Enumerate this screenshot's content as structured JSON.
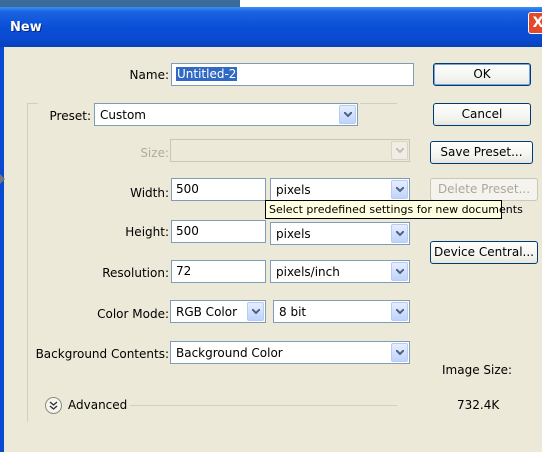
{
  "window": {
    "title": "New",
    "close_glyph": "X"
  },
  "form": {
    "name_label": "Name:",
    "name_value": "Untitled-2",
    "preset_label": "Preset:",
    "preset_value": "Custom",
    "size_label": "Size:",
    "size_value": "",
    "width_label": "Width:",
    "width_value": "500",
    "width_unit": "pixels",
    "height_label": "Height:",
    "height_value": "500",
    "height_unit": "pixels",
    "resolution_label": "Resolution:",
    "resolution_value": "72",
    "resolution_unit": "pixels/inch",
    "color_mode_label": "Color Mode:",
    "color_mode_value": "RGB Color",
    "bit_depth_value": "8 bit",
    "background_label": "Background Contents:",
    "background_value": "Background Color",
    "advanced_label": "Advanced"
  },
  "tooltip": {
    "text": "Select predefined settings for new documents"
  },
  "buttons": {
    "ok": "OK",
    "cancel": "Cancel",
    "save_preset": "Save Preset...",
    "delete_preset": "Delete Preset...",
    "device_central": "Device Central..."
  },
  "image_size": {
    "label": "Image Size:",
    "value": "732.4K"
  },
  "icons": {
    "dropdown": "chevron-down-icon",
    "advanced": "double-chevron-down-icon",
    "close": "close-icon"
  },
  "colors": {
    "titlebar": "#0A4AD0",
    "dialog_bg": "#ECE9D8",
    "selection": "#316AC5",
    "tooltip_bg": "#FFFFE1"
  }
}
